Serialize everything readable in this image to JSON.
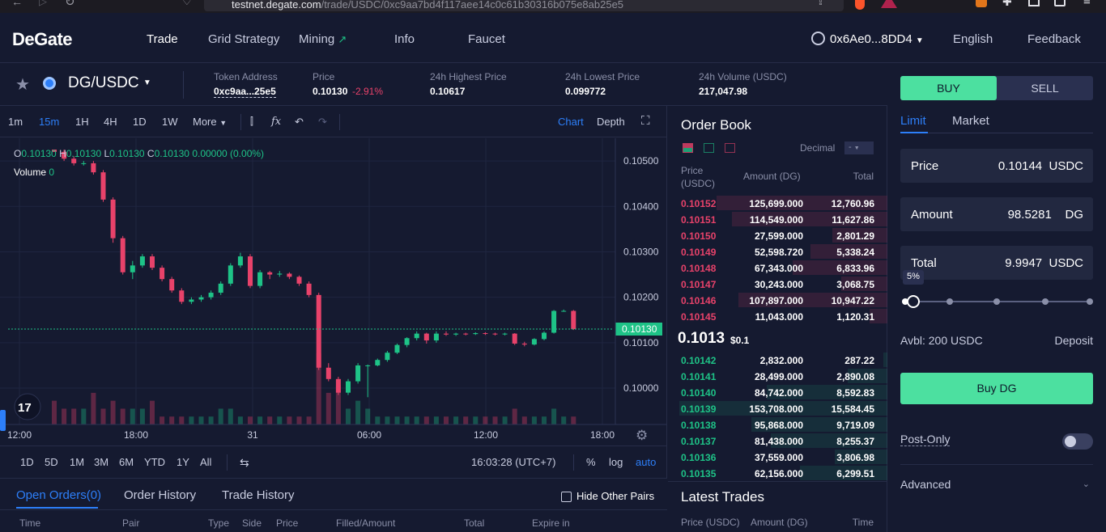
{
  "browser": {
    "url_host": "testnet.degate.com",
    "url_path": "/trade/USDC/0xc9aa7bd4f117aee14c0c61b30316b075e8ab25e5"
  },
  "header": {
    "logo": "DeGate",
    "nav": [
      "Trade",
      "Grid Strategy",
      "Mining",
      "Info",
      "Faucet"
    ],
    "account": "0x6Ae0...8DD4",
    "language": "English",
    "feedback": "Feedback"
  },
  "ticker": {
    "pair": "DG/USDC",
    "token_address_label": "Token Address",
    "token_address": "0xc9aa...25e5",
    "price_label": "Price",
    "price": "0.10130",
    "change": "-2.91%",
    "high_label": "24h Highest Price",
    "high": "0.10617",
    "low_label": "24h Lowest Price",
    "low": "0.099772",
    "volume_label": "24h Volume (USDC)",
    "volume": "217,047.98"
  },
  "chart_toolbar": {
    "intervals": [
      "1m",
      "15m",
      "1H",
      "4H",
      "1D",
      "1W"
    ],
    "active_interval": "15m",
    "more": "More",
    "chart_tab": "Chart",
    "depth_tab": "Depth"
  },
  "ohlc": {
    "o": "0.10130",
    "h": "0.10130",
    "l": "0.10130",
    "c": "0.10130",
    "change": "0.00000 (0.00%)",
    "volume_label": "Volume",
    "volume": "0"
  },
  "chart_data": {
    "type": "candlestick",
    "y_ticks": [
      "0.10500",
      "0.10400",
      "0.10300",
      "0.10200",
      "0.10100",
      "0.10000"
    ],
    "x_ticks": [
      "12:00",
      "18:00",
      "31",
      "06:00",
      "12:00",
      "18:00"
    ],
    "last_price": "0.10130",
    "ylim": [
      0.0992,
      0.1055
    ],
    "colors": {
      "up": "#1ec387",
      "down": "#e8426a"
    },
    "candles": [
      [
        0.10525,
        0.10525,
        0.1052,
        0.1052
      ],
      [
        0.1052,
        0.10525,
        0.105,
        0.10505
      ],
      [
        0.10505,
        0.1051,
        0.1049,
        0.10495
      ],
      [
        0.10495,
        0.105,
        0.1049,
        0.10495
      ],
      [
        0.10495,
        0.105,
        0.1047,
        0.10475
      ],
      [
        0.10475,
        0.1048,
        0.1041,
        0.10415
      ],
      [
        0.10415,
        0.1042,
        0.1032,
        0.1033
      ],
      [
        0.1033,
        0.10335,
        0.1025,
        0.10255
      ],
      [
        0.10255,
        0.1028,
        0.1024,
        0.1027
      ],
      [
        0.1027,
        0.10295,
        0.10265,
        0.1029
      ],
      [
        0.1029,
        0.10295,
        0.1026,
        0.10265
      ],
      [
        0.10265,
        0.1027,
        0.10235,
        0.1024
      ],
      [
        0.1024,
        0.10245,
        0.1021,
        0.10215
      ],
      [
        0.10215,
        0.1022,
        0.10185,
        0.1019
      ],
      [
        0.1019,
        0.102,
        0.10185,
        0.10195
      ],
      [
        0.10195,
        0.10205,
        0.1019,
        0.102
      ],
      [
        0.102,
        0.10215,
        0.10195,
        0.1021
      ],
      [
        0.1021,
        0.10235,
        0.10205,
        0.1023
      ],
      [
        0.1023,
        0.10275,
        0.10225,
        0.1027
      ],
      [
        0.1027,
        0.10298,
        0.10265,
        0.1029
      ],
      [
        0.1029,
        0.10295,
        0.1022,
        0.10225
      ],
      [
        0.10225,
        0.1026,
        0.1022,
        0.10255
      ],
      [
        0.10255,
        0.10258,
        0.1024,
        0.1025
      ],
      [
        0.1025,
        0.10258,
        0.10245,
        0.10252
      ],
      [
        0.10252,
        0.10255,
        0.1024,
        0.10245
      ],
      [
        0.10245,
        0.10248,
        0.10225,
        0.1023
      ],
      [
        0.1023,
        0.10235,
        0.102,
        0.10205
      ],
      [
        0.10205,
        0.1021,
        0.1004,
        0.10045
      ],
      [
        0.10045,
        0.10055,
        0.10015,
        0.1002
      ],
      [
        0.1002,
        0.10025,
        0.09985,
        0.0999
      ],
      [
        0.0999,
        0.1002,
        0.09985,
        0.10015
      ],
      [
        0.10015,
        0.10055,
        0.1001,
        0.1005
      ],
      [
        0.1005,
        0.10052,
        0.0998,
        0.1005
      ],
      [
        0.1005,
        0.10065,
        0.10048,
        0.10062
      ],
      [
        0.10062,
        0.10082,
        0.10058,
        0.10078
      ],
      [
        0.10078,
        0.10098,
        0.10075,
        0.10095
      ],
      [
        0.10095,
        0.10112,
        0.1009,
        0.1011
      ],
      [
        0.1011,
        0.10125,
        0.10105,
        0.1012
      ],
      [
        0.1012,
        0.10122,
        0.10098,
        0.10105
      ],
      [
        0.10105,
        0.10125,
        0.101,
        0.1012
      ],
      [
        0.1012,
        0.10125,
        0.10115,
        0.10118
      ],
      [
        0.10118,
        0.10122,
        0.10115,
        0.1012
      ],
      [
        0.1012,
        0.10122,
        0.10116,
        0.10119
      ],
      [
        0.10119,
        0.10123,
        0.10117,
        0.10121
      ],
      [
        0.10121,
        0.10123,
        0.10117,
        0.1012
      ],
      [
        0.1012,
        0.10122,
        0.10116,
        0.10119
      ],
      [
        0.10119,
        0.10122,
        0.10116,
        0.1012
      ],
      [
        0.1012,
        0.10121,
        0.10095,
        0.10098
      ],
      [
        0.10098,
        0.10102,
        0.10092,
        0.10096
      ],
      [
        0.10096,
        0.1011,
        0.10094,
        0.10108
      ],
      [
        0.10108,
        0.10125,
        0.10105,
        0.10122
      ],
      [
        0.10122,
        0.10172,
        0.1012,
        0.1017
      ],
      [
        0.1017,
        0.10173,
        0.10168,
        0.1017
      ],
      [
        0.1017,
        0.10172,
        0.10128,
        0.1013
      ]
    ],
    "volumes": [
      3,
      2,
      2,
      2,
      4,
      2,
      3,
      2,
      2,
      2,
      3,
      1,
      1,
      1,
      1,
      1,
      1,
      2,
      2,
      1,
      1,
      1,
      1,
      1,
      1,
      1,
      1,
      9,
      4,
      5,
      2,
      3,
      2,
      1,
      1,
      1,
      1,
      1,
      1,
      1,
      1,
      1,
      1,
      1,
      1,
      1,
      1,
      2,
      1,
      1,
      1,
      2,
      1,
      1
    ]
  },
  "chart_bottom": {
    "ranges": [
      "1D",
      "5D",
      "1M",
      "3M",
      "6M",
      "YTD",
      "1Y",
      "All"
    ],
    "time": "16:03:28 (UTC+7)",
    "pct": "%",
    "log": "log",
    "auto": "auto"
  },
  "orders": {
    "tabs": [
      "Open Orders(0)",
      "Order History",
      "Trade History"
    ],
    "hide_label": "Hide Other Pairs",
    "columns": [
      "Time",
      "Pair",
      "Type",
      "Side",
      "Price",
      "Filled/Amount",
      "Total",
      "Expire in"
    ]
  },
  "orderbook": {
    "title": "Order Book",
    "decimal_label": "Decimal",
    "decimal_value": "-",
    "col_price": "Price (USDC)",
    "col_amount": "Amount (DG)",
    "col_total": "Total",
    "asks": [
      [
        "0.10152",
        "125,699.000",
        "12,760.96",
        0.78
      ],
      [
        "0.10151",
        "114,549.000",
        "11,627.86",
        0.71
      ],
      [
        "0.10150",
        "27,599.000",
        "2,801.29",
        0.25
      ],
      [
        "0.10149",
        "52,598.720",
        "5,338.24",
        0.35
      ],
      [
        "0.10148",
        "67,343.000",
        "6,833.96",
        0.43
      ],
      [
        "0.10147",
        "30,243.000",
        "3,068.75",
        0.21
      ],
      [
        "0.10146",
        "107,897.000",
        "10,947.22",
        0.68
      ],
      [
        "0.10145",
        "11,043.000",
        "1,120.31",
        0.08
      ]
    ],
    "mid_price": "0.1013",
    "mid_usd": "$0.1",
    "bids": [
      [
        "0.10142",
        "2,832.000",
        "287.22",
        0.02
      ],
      [
        "0.10141",
        "28,499.000",
        "2,890.08",
        0.18
      ],
      [
        "0.10140",
        "84,742.000",
        "8,592.83",
        0.55
      ],
      [
        "0.10139",
        "153,708.000",
        "15,584.45",
        0.95
      ],
      [
        "0.10138",
        "95,868.000",
        "9,719.09",
        0.62
      ],
      [
        "0.10137",
        "81,438.000",
        "8,255.37",
        0.53
      ],
      [
        "0.10136",
        "37,559.000",
        "3,806.98",
        0.24
      ],
      [
        "0.10135",
        "62,156.000",
        "6,299.51",
        0.4
      ]
    ],
    "latest_title": "Latest Trades",
    "latest_cols": [
      "Price (USDC)",
      "Amount (DG)",
      "Time"
    ]
  },
  "trade": {
    "buy": "BUY",
    "sell": "SELL",
    "limit": "Limit",
    "market": "Market",
    "price_label": "Price",
    "price": "0.10144",
    "price_unit": "USDC",
    "amount_label": "Amount",
    "amount": "98.5281",
    "amount_unit": "DG",
    "total_label": "Total",
    "total": "9.9947",
    "total_unit": "USDC",
    "slider_pct": "5%",
    "slider_value": 0.05,
    "avbl": "Avbl: 200 USDC",
    "deposit": "Deposit",
    "buy_button": "Buy DG",
    "post_only": "Post-Only",
    "advanced": "Advanced"
  }
}
